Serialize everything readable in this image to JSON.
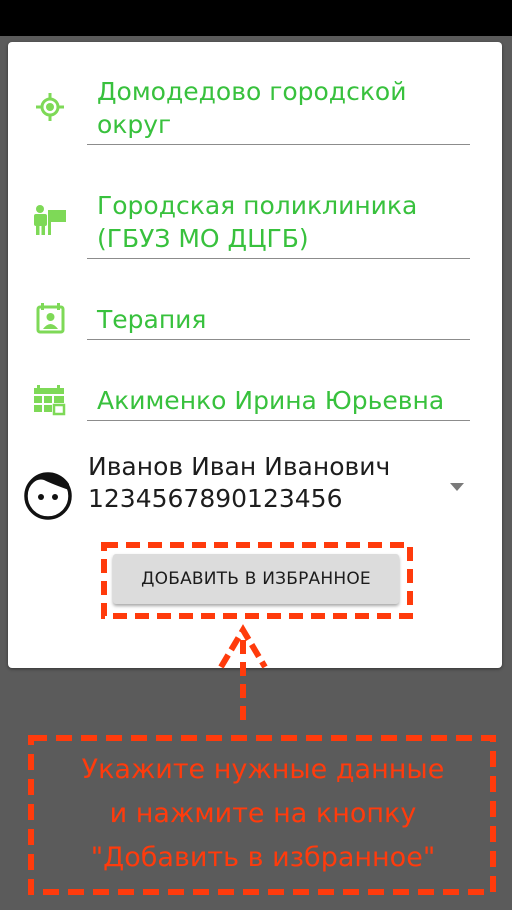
{
  "status_bar": {},
  "form": {
    "district": "Домодедово городской округ",
    "clinic": "Городская поликлиника (ГБУЗ МО ДЦГБ)",
    "specialty": "Терапия",
    "doctor": "Акименко Ирина Юрьевна"
  },
  "patient": {
    "name": "Иванов Иван Иванович",
    "policy_number": "1234567890123456"
  },
  "add_button_label": "ДОБАВИТЬ В ИЗБРАННОЕ",
  "hint": {
    "line1": "Укажите нужные данные",
    "line2": "и нажмите на кнопку",
    "line3": "\"Добавить в избранное\""
  },
  "colors": {
    "accent_green": "#38c13d",
    "icon_green": "#7ed957",
    "annotation_red": "#ff3b0c",
    "backdrop": "#5b5b5b"
  },
  "icons": {
    "district": "location-target-icon",
    "clinic": "hospital-person-icon",
    "specialty": "calendar-person-icon",
    "doctor": "calendar-grid-icon",
    "patient": "face-icon",
    "dropdown": "triangle-down-icon"
  }
}
